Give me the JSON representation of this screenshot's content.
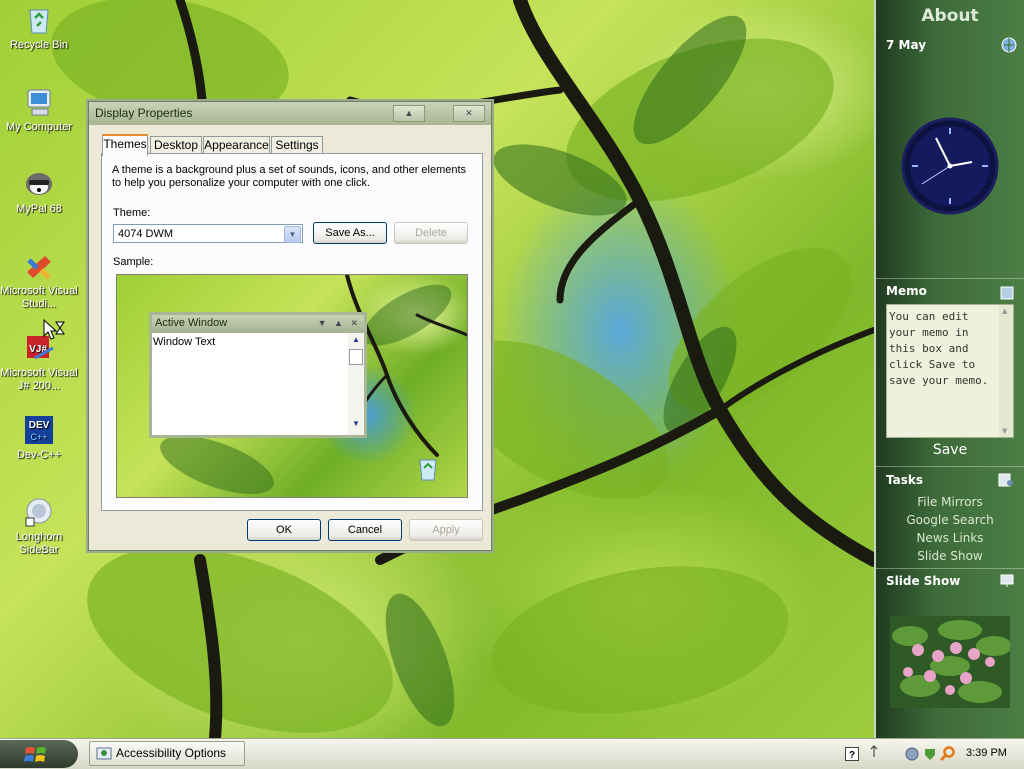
{
  "colors": {
    "sidebar_bg": "#3d6b3a",
    "dialog_title": "#a8b594",
    "tab_accent": "#e68b2c",
    "desktop_leaf": "#9fcf35"
  },
  "desktop": {
    "icons": [
      {
        "label": "Recycle Bin",
        "icon": "recycle-bin-icon"
      },
      {
        "label": "My Computer",
        "icon": "computer-icon"
      },
      {
        "label": "MyPal 68",
        "icon": "mypal-icon"
      },
      {
        "label": "Microsoft Visual Studi...",
        "icon": "visual-studio-icon"
      },
      {
        "label": "Microsoft Visual J# 200...",
        "icon": "visual-jsharp-icon"
      },
      {
        "label": "Dev-C++",
        "icon": "devcpp-icon"
      },
      {
        "label": "Longhorn SideBar",
        "icon": "longhorn-sidebar-icon"
      }
    ]
  },
  "dialog": {
    "title": "Display Properties",
    "tabs": [
      "Themes",
      "Desktop",
      "Appearance",
      "Settings"
    ],
    "description": "A theme is a background plus a set of sounds, icons, and other elements to help you personalize your computer with one click.",
    "theme_label": "Theme:",
    "theme_value": "4074 DWM",
    "save_as": "Save As...",
    "delete": "Delete",
    "sample_label": "Sample:",
    "sample_window_title": "Active Window",
    "sample_window_text": "Window Text",
    "ok": "OK",
    "cancel": "Cancel",
    "apply": "Apply"
  },
  "sidebar": {
    "about": "About",
    "date": "7 May",
    "memo_title": "Memo",
    "memo_text": "You can edit your memo in this box and click Save to save your memo.",
    "memo_save": "Save",
    "tasks_title": "Tasks",
    "tasks": [
      "File Mirrors",
      "Google Search",
      "News Links",
      "Slide Show"
    ],
    "slideshow_title": "Slide Show"
  },
  "taskbar": {
    "task_button": "Accessibility Options",
    "clock": "3:39 PM"
  }
}
